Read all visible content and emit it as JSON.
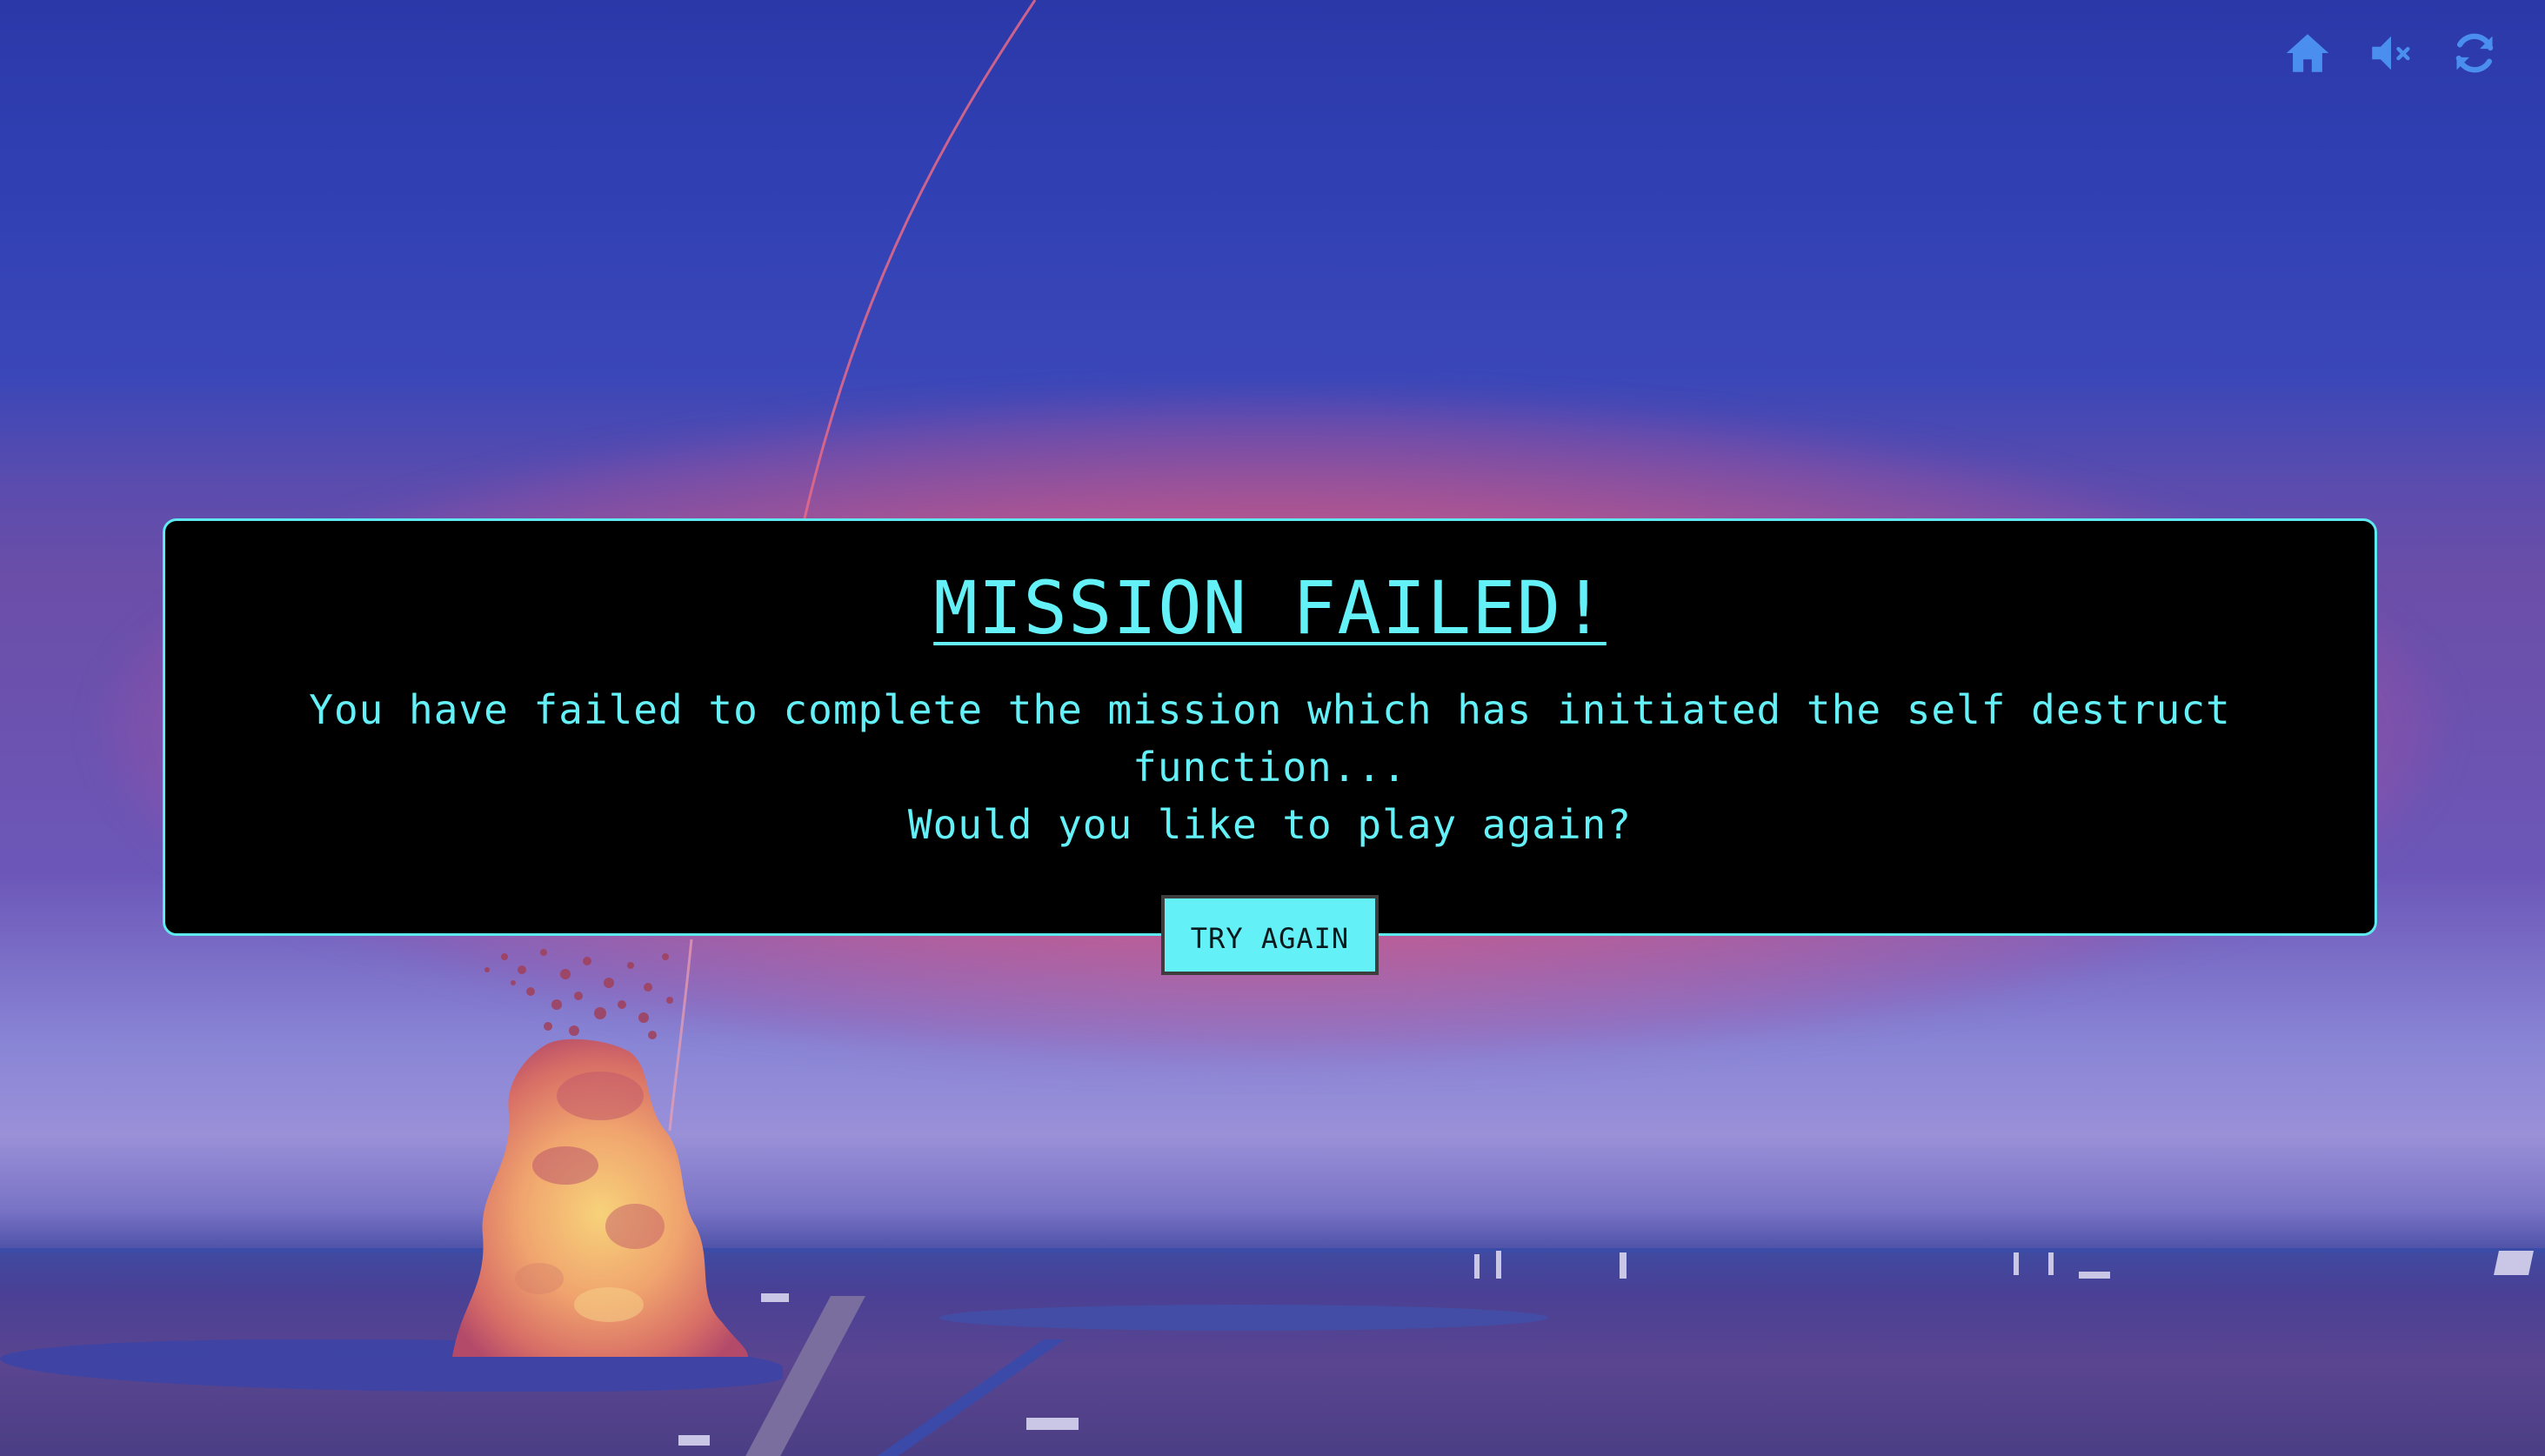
{
  "modal": {
    "title": "MISSION FAILED!",
    "line1": "You have failed to complete the mission which has initiated the self destruct function...",
    "line2": "Would you like to play again?",
    "try_again_label": "TRY AGAIN"
  },
  "controls": [
    {
      "icon": "home-icon"
    },
    {
      "icon": "mute-icon"
    },
    {
      "icon": "refresh-icon"
    }
  ],
  "colors": {
    "accent": "#63f1f7",
    "panel_bg": "#000000",
    "icon": "#4a8ff0"
  }
}
